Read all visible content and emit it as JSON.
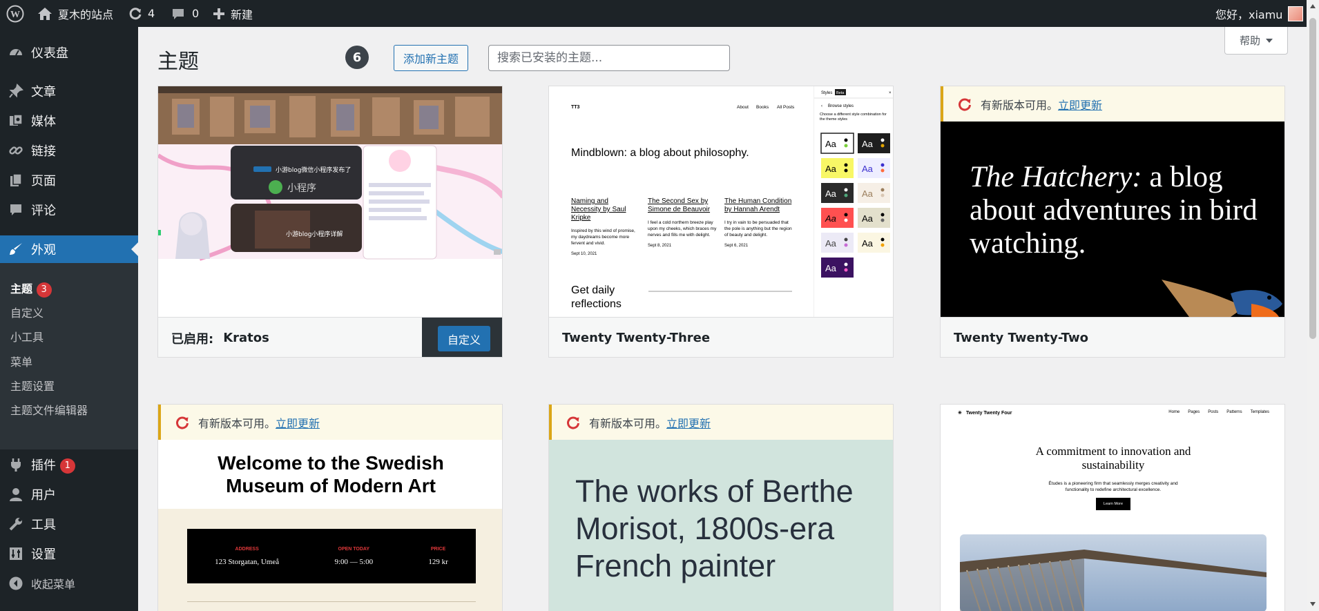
{
  "adminbar": {
    "site_name": "夏木的站点",
    "updates_count": "4",
    "comments_count": "0",
    "new_label": "新建",
    "greeting": "您好，xiamu"
  },
  "sidebar": {
    "dashboard": "仪表盘",
    "posts": "文章",
    "media": "媒体",
    "links": "链接",
    "pages": "页面",
    "comments": "评论",
    "appearance": "外观",
    "submenu": {
      "themes": "主题",
      "themes_badge": "3",
      "customize": "自定义",
      "widgets": "小工具",
      "menus": "菜单",
      "theme_settings": "主题设置",
      "theme_editor": "主题文件编辑器"
    },
    "plugins": "插件",
    "plugins_badge": "1",
    "users": "用户",
    "tools": "工具",
    "settings": "设置",
    "collapse": "收起菜单"
  },
  "header": {
    "title": "主题",
    "count": "6",
    "add_new": "添加新主题",
    "search_placeholder": "搜索已安装的主题...",
    "help": "帮助"
  },
  "themes": {
    "active_label": "已启用:",
    "active_name": "Kratos",
    "customize": "自定义",
    "update_notice": "有新版本可用。",
    "update_link": "立即更新",
    "tt3": {
      "name": "Twenty Twenty-Three",
      "logo": "TT3",
      "nav": [
        "About",
        "Books",
        "All Posts"
      ],
      "headline": "Mindblown: a blog about philosophy.",
      "posts": [
        {
          "title": "Naming and Necessity by Saul Kripke",
          "excerpt": "Inspired by this wind of promise, my daydreams become more fervent and vivid.",
          "date": "Sept 10, 2021"
        },
        {
          "title": "The Second Sex by Simone de Beauvoir",
          "excerpt": "I feel a cold northern breeze play upon my cheeks, which braces my nerves and fills me with delight.",
          "date": "Sept 8, 2021"
        },
        {
          "title": "The Human Condition by Hannah Arendt",
          "excerpt": "I try in vain to be persuaded that the pole is anything but the region of beauty and delight.",
          "date": "Sept 6, 2021"
        }
      ],
      "footer_text": "Get daily reflections",
      "styles_title": "Styles",
      "styles_beta": "Beta",
      "browse": "Browse styles",
      "browse_desc": "Choose a different style combination for the theme styles",
      "swatch_label": "Aa"
    },
    "tt2": {
      "name": "Twenty Twenty-Two",
      "headline_italic": "The Hatchery:",
      "headline_rest": "a blog about adventures in bird watching."
    },
    "tt1": {
      "headline": "Welcome to the Swedish Museum of Modern Art",
      "address_label": "ADDRESS",
      "address": "123 Storgatan, Umeå",
      "hours_label": "OPEN TODAY",
      "hours": "9:00 — 5:00",
      "price_label": "PRICE",
      "price": "129 kr"
    },
    "t21": {
      "headline": "The works of Berthe Morisot, 1800s-era French painter"
    },
    "tt4": {
      "site": "Twenty Twenty Four",
      "nav": [
        "Home",
        "Pages",
        "Posts",
        "Patterns",
        "Templates"
      ],
      "headline": "A commitment to innovation and sustainability",
      "sub": "Études is a pioneering firm that seamlessly merges creativity and functionality to redefine architectural excellence.",
      "button": "Learn More"
    },
    "kratos": {
      "banner1": "小游blog微信小程序发布了",
      "mini": "小程序",
      "banner2": "小游blog小程序详解"
    }
  },
  "colors": {
    "accent": "#2271b1",
    "adminbar": "#1d2327",
    "badge": "#d63638",
    "notice_border": "#dba617"
  }
}
